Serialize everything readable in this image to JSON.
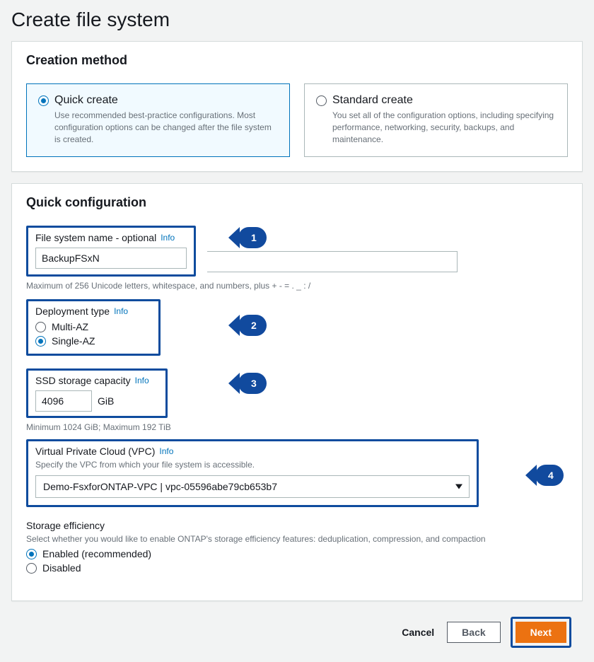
{
  "page_title": "Create file system",
  "method_panel": {
    "title": "Creation method",
    "quick": {
      "label": "Quick create",
      "desc": "Use recommended best-practice configurations. Most configuration options can be changed after the file system is created."
    },
    "standard": {
      "label": "Standard create",
      "desc": "You set all of the configuration options, including specifying performance, networking, security, backups, and maintenance."
    }
  },
  "config_panel": {
    "title": "Quick configuration",
    "name": {
      "label": "File system name - optional",
      "value": "BackupFSxN",
      "help": "Maximum of 256 Unicode letters, whitespace, and numbers, plus + - = . _ : /"
    },
    "deployment": {
      "label": "Deployment type",
      "multi": "Multi-AZ",
      "single": "Single-AZ"
    },
    "capacity": {
      "label": "SSD storage capacity",
      "value": "4096",
      "unit": "GiB",
      "help": "Minimum 1024 GiB; Maximum 192 TiB"
    },
    "vpc": {
      "label": "Virtual Private Cloud (VPC)",
      "desc": "Specify the VPC from which your file system is accessible.",
      "value": "Demo-FsxforONTAP-VPC | vpc-05596abe79cb653b7"
    },
    "storage_eff": {
      "label": "Storage efficiency",
      "desc": "Select whether you would like to enable ONTAP's storage efficiency features: deduplication, compression, and compaction",
      "enabled": "Enabled (recommended)",
      "disabled": "Disabled"
    },
    "info_label": "Info"
  },
  "buttons": {
    "cancel": "Cancel",
    "back": "Back",
    "next": "Next"
  },
  "callouts": {
    "c1": "1",
    "c2": "2",
    "c3": "3",
    "c4": "4"
  }
}
